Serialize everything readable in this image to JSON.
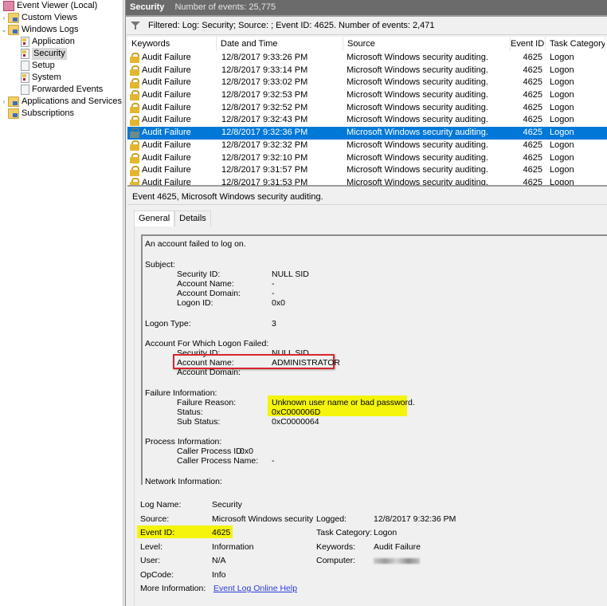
{
  "tree": {
    "items": [
      {
        "label": "Event Viewer (Local)",
        "icon": "event-viewer-icon",
        "level": 0,
        "chevron": ""
      },
      {
        "label": "Custom Views",
        "icon": "folder-icon",
        "level": 1,
        "chevron": "›"
      },
      {
        "label": "Windows Logs",
        "icon": "folder-icon",
        "level": 1,
        "chevron": "⌄"
      },
      {
        "label": "Application",
        "icon": "log-icon",
        "level": 2,
        "chevron": ""
      },
      {
        "label": "Security",
        "icon": "log-icon",
        "level": 2,
        "chevron": "",
        "selected": true
      },
      {
        "label": "Setup",
        "icon": "log-icon",
        "level": 2,
        "chevron": ""
      },
      {
        "label": "System",
        "icon": "log-icon",
        "level": 2,
        "chevron": ""
      },
      {
        "label": "Forwarded Events",
        "icon": "log-icon",
        "level": 2,
        "chevron": ""
      },
      {
        "label": "Applications and Services Lo",
        "icon": "folder-icon",
        "level": 1,
        "chevron": "›"
      },
      {
        "label": "Subscriptions",
        "icon": "subscriptions-icon",
        "level": 1,
        "chevron": ""
      }
    ]
  },
  "header": {
    "log_name": "Security",
    "count_text": "Number of events: 25,775"
  },
  "filter": {
    "icon": "filter-icon",
    "text": "Filtered: Log: Security; Source: ; Event ID: 4625. Number of events: 2,471"
  },
  "grid": {
    "columns": [
      "Keywords",
      "Date and Time",
      "Source",
      "Event ID",
      "Task Category"
    ],
    "rows": [
      {
        "keywords": "Audit Failure",
        "datetime": "12/8/2017 9:33:26 PM",
        "source": "Microsoft Windows security auditing.",
        "event_id": "4625",
        "task": "Logon"
      },
      {
        "keywords": "Audit Failure",
        "datetime": "12/8/2017 9:33:14 PM",
        "source": "Microsoft Windows security auditing.",
        "event_id": "4625",
        "task": "Logon"
      },
      {
        "keywords": "Audit Failure",
        "datetime": "12/8/2017 9:33:02 PM",
        "source": "Microsoft Windows security auditing.",
        "event_id": "4625",
        "task": "Logon"
      },
      {
        "keywords": "Audit Failure",
        "datetime": "12/8/2017 9:32:53 PM",
        "source": "Microsoft Windows security auditing.",
        "event_id": "4625",
        "task": "Logon"
      },
      {
        "keywords": "Audit Failure",
        "datetime": "12/8/2017 9:32:52 PM",
        "source": "Microsoft Windows security auditing.",
        "event_id": "4625",
        "task": "Logon"
      },
      {
        "keywords": "Audit Failure",
        "datetime": "12/8/2017 9:32:43 PM",
        "source": "Microsoft Windows security auditing.",
        "event_id": "4625",
        "task": "Logon"
      },
      {
        "keywords": "Audit Failure",
        "datetime": "12/8/2017 9:32:36 PM",
        "source": "Microsoft Windows security auditing.",
        "event_id": "4625",
        "task": "Logon",
        "selected": true
      },
      {
        "keywords": "Audit Failure",
        "datetime": "12/8/2017 9:32:32 PM",
        "source": "Microsoft Windows security auditing.",
        "event_id": "4625",
        "task": "Logon"
      },
      {
        "keywords": "Audit Failure",
        "datetime": "12/8/2017 9:32:10 PM",
        "source": "Microsoft Windows security auditing.",
        "event_id": "4625",
        "task": "Logon"
      },
      {
        "keywords": "Audit Failure",
        "datetime": "12/8/2017 9:31:57 PM",
        "source": "Microsoft Windows security auditing.",
        "event_id": "4625",
        "task": "Logon"
      },
      {
        "keywords": "Audit Failure",
        "datetime": "12/8/2017 9:31:53 PM",
        "source": "Microsoft Windows security auditing.",
        "event_id": "4625",
        "task": "Logon"
      }
    ]
  },
  "detail": {
    "title": "Event 4625, Microsoft Windows security auditing.",
    "tabs": [
      "General",
      "Details"
    ],
    "active_tab": "General",
    "description": {
      "intro": "An account failed to log on.",
      "subject_heading": "Subject:",
      "subject": [
        {
          "label": "Security ID:",
          "value": "NULL SID"
        },
        {
          "label": "Account Name:",
          "value": "-"
        },
        {
          "label": "Account Domain:",
          "value": "-"
        },
        {
          "label": "Logon ID:",
          "value": "0x0"
        }
      ],
      "logon_type_label": "Logon Type:",
      "logon_type_value": "3",
      "failed_heading": "Account For Which Logon Failed:",
      "failed": [
        {
          "label": "Security ID:",
          "value": "NULL SID"
        },
        {
          "label": "Account Name:",
          "value": "ADMINISTRATOR"
        },
        {
          "label": "Account Domain:",
          "value": ""
        }
      ],
      "failure_heading": "Failure Information:",
      "failure": [
        {
          "label": "Failure Reason:",
          "value": "Unknown user name or bad password."
        },
        {
          "label": "Status:",
          "value": "0xC000006D"
        },
        {
          "label": "Sub Status:",
          "value": "0xC0000064"
        }
      ],
      "process_heading": "Process Information:",
      "process": [
        {
          "label": "Caller Process ID:",
          "value": "0x0"
        },
        {
          "label": "Caller Process Name:",
          "value": "-"
        }
      ],
      "network_heading": "Network Information:"
    },
    "meta": {
      "log_name_label": "Log Name:",
      "log_name": "Security",
      "source_label": "Source:",
      "source": "Microsoft Windows security",
      "event_id_label": "Event ID:",
      "event_id": "4625",
      "level_label": "Level:",
      "level": "Information",
      "user_label": "User:",
      "user": "N/A",
      "opcode_label": "OpCode:",
      "opcode": "Info",
      "more_info_label": "More Information:",
      "more_info_link": "Event Log Online Help",
      "logged_label": "Logged:",
      "logged": "12/8/2017 9:32:36 PM",
      "task_label": "Task Category:",
      "task": "Logon",
      "keywords_label": "Keywords:",
      "keywords": "Audit Failure",
      "computer_label": "Computer:",
      "computer": ""
    }
  },
  "colors": {
    "selection": "#0078d7",
    "highlight": "#f4f40c",
    "annotation_box": "#d8262c",
    "header_bg": "#6b6b6b"
  }
}
